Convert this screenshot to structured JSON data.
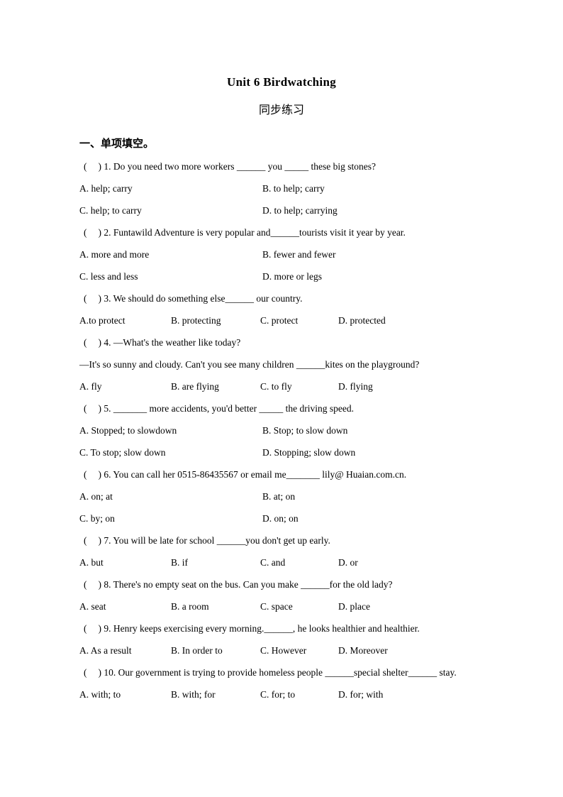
{
  "document": {
    "title": "Unit 6 Birdwatching",
    "subtitle": "同步练习",
    "section_heading": "一、单项填空。"
  },
  "questions": [
    {
      "marker_open": "(",
      "marker_close": ")",
      "number": "1.",
      "stem": "Do you need two more workers ______ you _____ these big stones?",
      "layout": "cols2",
      "options": [
        "A. help; carry",
        "B. to help; carry",
        "C. help; to carry",
        "D. to help; carrying"
      ]
    },
    {
      "marker_open": "(",
      "marker_close": ")",
      "number": "2.",
      "stem": "Funtawild Adventure is very popular and______tourists visit it year by year.",
      "layout": "cols2",
      "options": [
        "A. more and more",
        "B. fewer and fewer",
        "C. less and less",
        "D. more or legs"
      ]
    },
    {
      "marker_open": "(",
      "marker_close": ")",
      "number": "3.",
      "stem": "We should do something else______ our country.",
      "layout": "cols4",
      "options": [
        "A.to protect",
        "B. protecting",
        "C. protect",
        "D. protected"
      ]
    },
    {
      "marker_open": "(",
      "marker_close": ")",
      "number": "4.",
      "stem": "—What's the weather like today?",
      "continuation": "—It's so sunny and cloudy. Can't you see many children ______kites on the playground?",
      "layout": "cols4",
      "options": [
        "A. fly",
        "B. are flying",
        "C. to fly",
        "D. flying"
      ]
    },
    {
      "marker_open": "(",
      "marker_close": ")",
      "number": "5.",
      "stem": "_______ more accidents, you'd better _____ the driving speed.",
      "layout": "cols2",
      "options": [
        "A. Stopped; to slowdown",
        "B. Stop; to slow down",
        "C. To stop; slow down",
        "D. Stopping; slow down"
      ]
    },
    {
      "marker_open": "(",
      "marker_close": ")",
      "number": "6.",
      "stem": "You can call her 0515-86435567 or email me_______ lily@ Huaian.com.cn.",
      "layout": "cols2",
      "options": [
        "A. on; at",
        "B. at; on",
        "C. by; on",
        "D. on; on"
      ]
    },
    {
      "marker_open": "(",
      "marker_close": ")",
      "number": "7.",
      "stem": "You will be late for school  ______you don't get up early.",
      "layout": "cols4",
      "options": [
        "A. but",
        "B. if",
        "C. and",
        "D. or"
      ]
    },
    {
      "marker_open": "(",
      "marker_close": ")",
      "number": "8.",
      "stem": "There's no empty seat on the bus. Can you make ______for the old lady?",
      "layout": "cols4",
      "options": [
        "A. seat",
        "B. a room",
        "C. space",
        "D. place"
      ]
    },
    {
      "marker_open": "(",
      "marker_close": ")",
      "number": "9.",
      "stem": "Henry keeps exercising every morning.______, he looks healthier and healthier.",
      "layout": "cols4",
      "options": [
        "A. As a result",
        "B. In order to",
        "C. However",
        "D. Moreover"
      ]
    },
    {
      "marker_open": "(",
      "marker_close": ")",
      "number": "10.",
      "stem": "Our government is trying to provide homeless people ______special shelter______ stay.",
      "layout": "cols4",
      "options": [
        "A. with; to",
        "B. with; for",
        "C. for; to",
        "D. for; with"
      ]
    }
  ]
}
